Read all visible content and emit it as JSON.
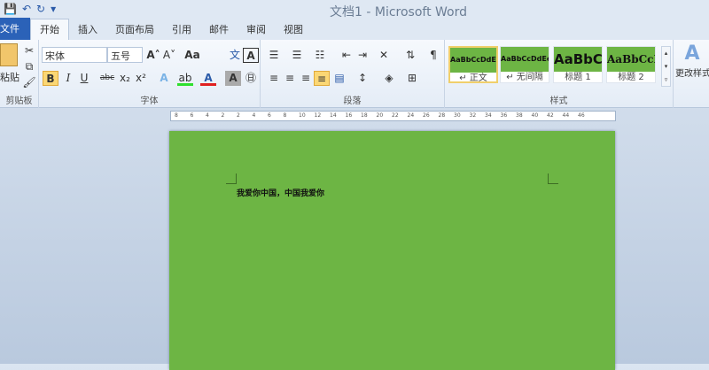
{
  "title": "文档1 - Microsoft Word",
  "qat": {
    "save": "💾",
    "undo": "↶",
    "redo": "↻",
    "more": "▾"
  },
  "tabs": [
    "文件",
    "开始",
    "插入",
    "页面布局",
    "引用",
    "邮件",
    "审阅",
    "视图"
  ],
  "clipboard": {
    "paste": "粘贴",
    "label": "剪贴板"
  },
  "font": {
    "name": "宋体",
    "size": "五号",
    "label": "字体",
    "bold": "B",
    "italic": "I",
    "underline": "U",
    "strike": "abc",
    "sub": "x₂",
    "sup": "x²",
    "grow": "A˄",
    "shrink": "A˅",
    "case": "Aa",
    "clear": "A",
    "char_border": "A",
    "phonetic": "文"
  },
  "paragraph": {
    "label": "段落"
  },
  "styles": {
    "label": "样式",
    "items": [
      {
        "preview": "AaBbCcDdEe",
        "name": "↵ 正文"
      },
      {
        "preview": "AaBbCcDdEe",
        "name": "↵ 无间隔"
      },
      {
        "preview": "AaBbC",
        "name": "标题 1"
      },
      {
        "preview": "AaBbCcI",
        "name": "标题 2"
      }
    ],
    "change": "更改样式"
  },
  "ruler": [
    "8",
    "6",
    "4",
    "2",
    "2",
    "4",
    "6",
    "8",
    "10",
    "12",
    "14",
    "16",
    "18",
    "20",
    "22",
    "24",
    "26",
    "28",
    "30",
    "32",
    "34",
    "36",
    "38",
    "40",
    "42",
    "44",
    "46"
  ],
  "document": {
    "text": "我爱你中国，中国我爱你",
    "page_color": "#6db544"
  }
}
